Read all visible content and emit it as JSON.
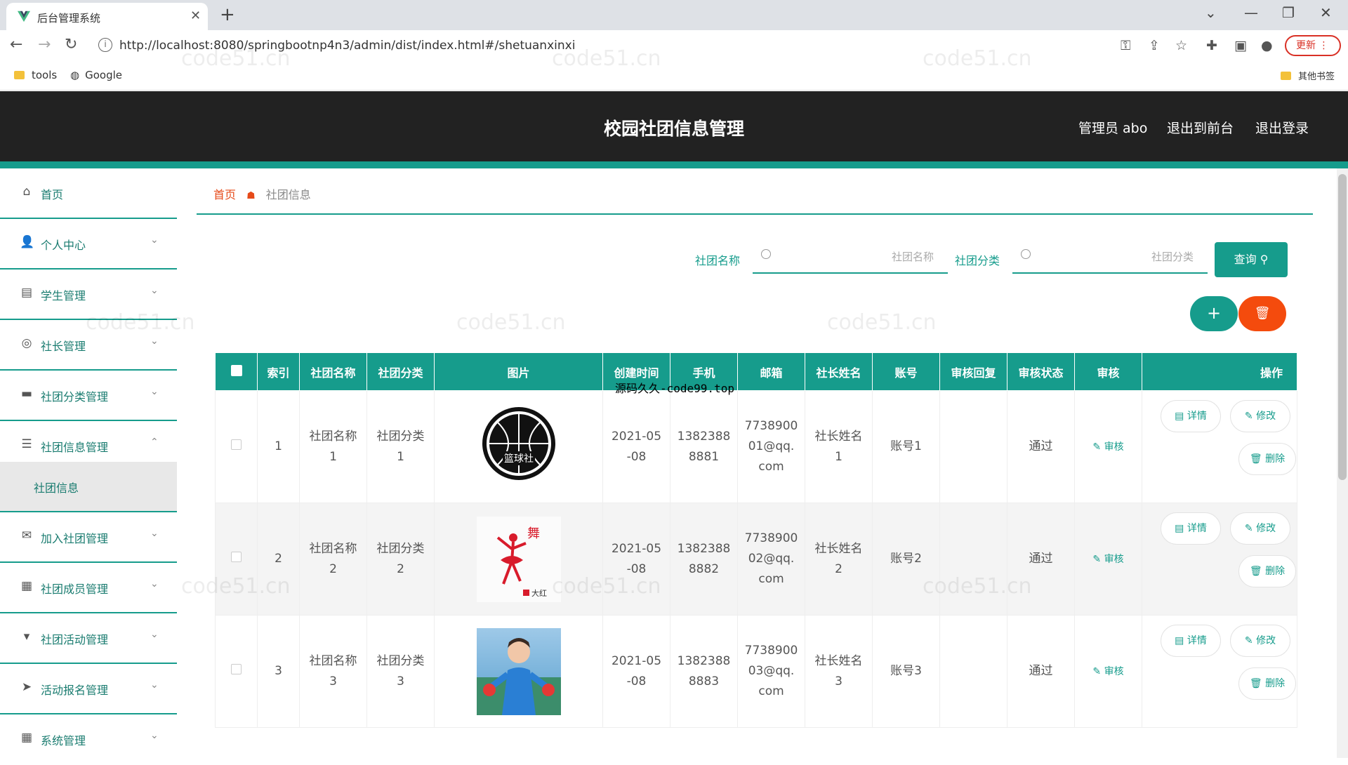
{
  "browser": {
    "tab_title": "后台管理系统",
    "url": "http://localhost:8080/springbootnp4n3/admin/dist/index.html#/shetuanxinxi",
    "update_label": "更新",
    "bookmarks": [
      "tools",
      "Google"
    ],
    "other_bookmarks": "其他书签"
  },
  "header": {
    "title": "校园社团信息管理",
    "admin": "管理员 abo",
    "to_front": "退出到前台",
    "logout": "退出登录"
  },
  "sidebar": {
    "items": [
      {
        "label": "首页",
        "icon": "home-icon"
      },
      {
        "label": "个人中心",
        "icon": "user-icon"
      },
      {
        "label": "学生管理",
        "icon": "clipboard-icon"
      },
      {
        "label": "社长管理",
        "icon": "compass-icon"
      },
      {
        "label": "社团分类管理",
        "icon": "printer-icon"
      },
      {
        "label": "社团信息管理",
        "icon": "menu-icon"
      },
      {
        "label": "加入社团管理",
        "icon": "mail-icon"
      },
      {
        "label": "社团成员管理",
        "icon": "document-icon"
      },
      {
        "label": "社团活动管理",
        "icon": "cup-icon"
      },
      {
        "label": "活动报名管理",
        "icon": "send-icon"
      },
      {
        "label": "系统管理",
        "icon": "grid-icon"
      }
    ],
    "submenu": "社团信息"
  },
  "breadcrumb": {
    "home": "首页",
    "current": "社团信息"
  },
  "search": {
    "name_label": "社团名称",
    "name_placeholder": "社团名称",
    "type_label": "社团分类",
    "type_placeholder": "社团分类",
    "query_label": "查询"
  },
  "table": {
    "headers": [
      "索引",
      "社团名称",
      "社团分类",
      "图片",
      "创建时间",
      "手机",
      "邮箱",
      "社长姓名",
      "账号",
      "审核回复",
      "审核状态",
      "审核",
      "操作"
    ],
    "rows": [
      {
        "index": "1",
        "name": [
          "社团名称",
          "1"
        ],
        "type": [
          "社团分类",
          "1"
        ],
        "image_label": "篮球社",
        "date": [
          "2021-05",
          "-08"
        ],
        "phone": [
          "1382388",
          "8881"
        ],
        "email": [
          "7738900",
          "01@qq.",
          "com"
        ],
        "leader": [
          "社长姓名",
          "1"
        ],
        "account": "账号1",
        "reply": "",
        "status": "通过"
      },
      {
        "index": "2",
        "name": [
          "社团名称",
          "2"
        ],
        "type": [
          "社团分类",
          "2"
        ],
        "image_label": "大红",
        "date": [
          "2021-05",
          "-08"
        ],
        "phone": [
          "1382388",
          "8882"
        ],
        "email": [
          "7738900",
          "02@qq.",
          "com"
        ],
        "leader": [
          "社长姓名",
          "2"
        ],
        "account": "账号2",
        "reply": "",
        "status": "通过"
      },
      {
        "index": "3",
        "name": [
          "社团名称",
          "3"
        ],
        "type": [
          "社团分类",
          "3"
        ],
        "image_label": "",
        "date": [
          "2021-05",
          "-08"
        ],
        "phone": [
          "1382388",
          "8883"
        ],
        "email": [
          "7738900",
          "03@qq.",
          "com"
        ],
        "leader": [
          "社长姓名",
          "3"
        ],
        "account": "账号3",
        "reply": "",
        "status": "通过"
      }
    ],
    "audit_label": "审核",
    "detail_label": "详情",
    "edit_label": "修改",
    "delete_label": "删除"
  },
  "watermark": "code51.cn",
  "overlay_text": "源码久久-code99.top",
  "colors": {
    "primary": "#169c8c",
    "danger": "#f44b0d",
    "header": "#222222"
  }
}
